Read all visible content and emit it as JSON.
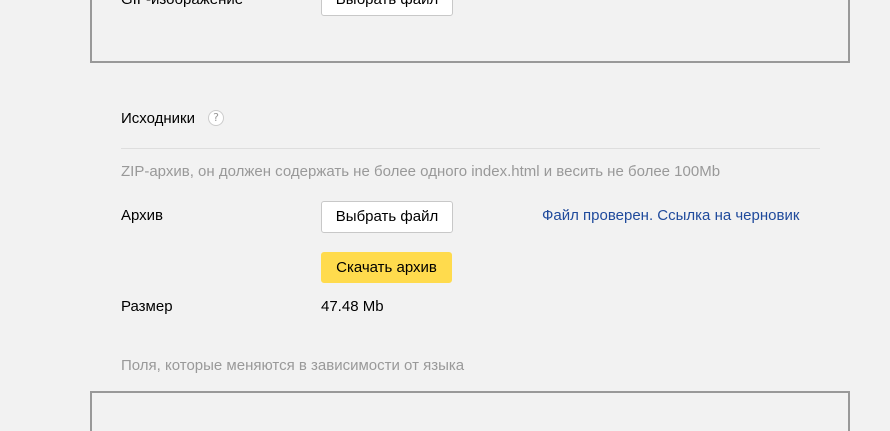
{
  "previous_section": {
    "label": "GIF-изображение",
    "choose_file_label": "Выбрать файл"
  },
  "sources_section": {
    "title": "Исходники",
    "help_icon": "?",
    "hint": "ZIP-архив, он должен содержать не более одного index.html и весить не более 100Mb",
    "archive_label": "Архив",
    "choose_file_label": "Выбрать файл",
    "status_link": "Файл проверен. Ссылка на черновик",
    "download_label": "Скачать архив",
    "size_label": "Размер",
    "size_value": "47.48 Mb"
  },
  "language_fields_hint": "Поля, которые меняются в зависимости от языка",
  "colors": {
    "accent_yellow": "#ffdb4d",
    "link_blue": "#1f4a9c",
    "hint_gray": "#999999"
  }
}
